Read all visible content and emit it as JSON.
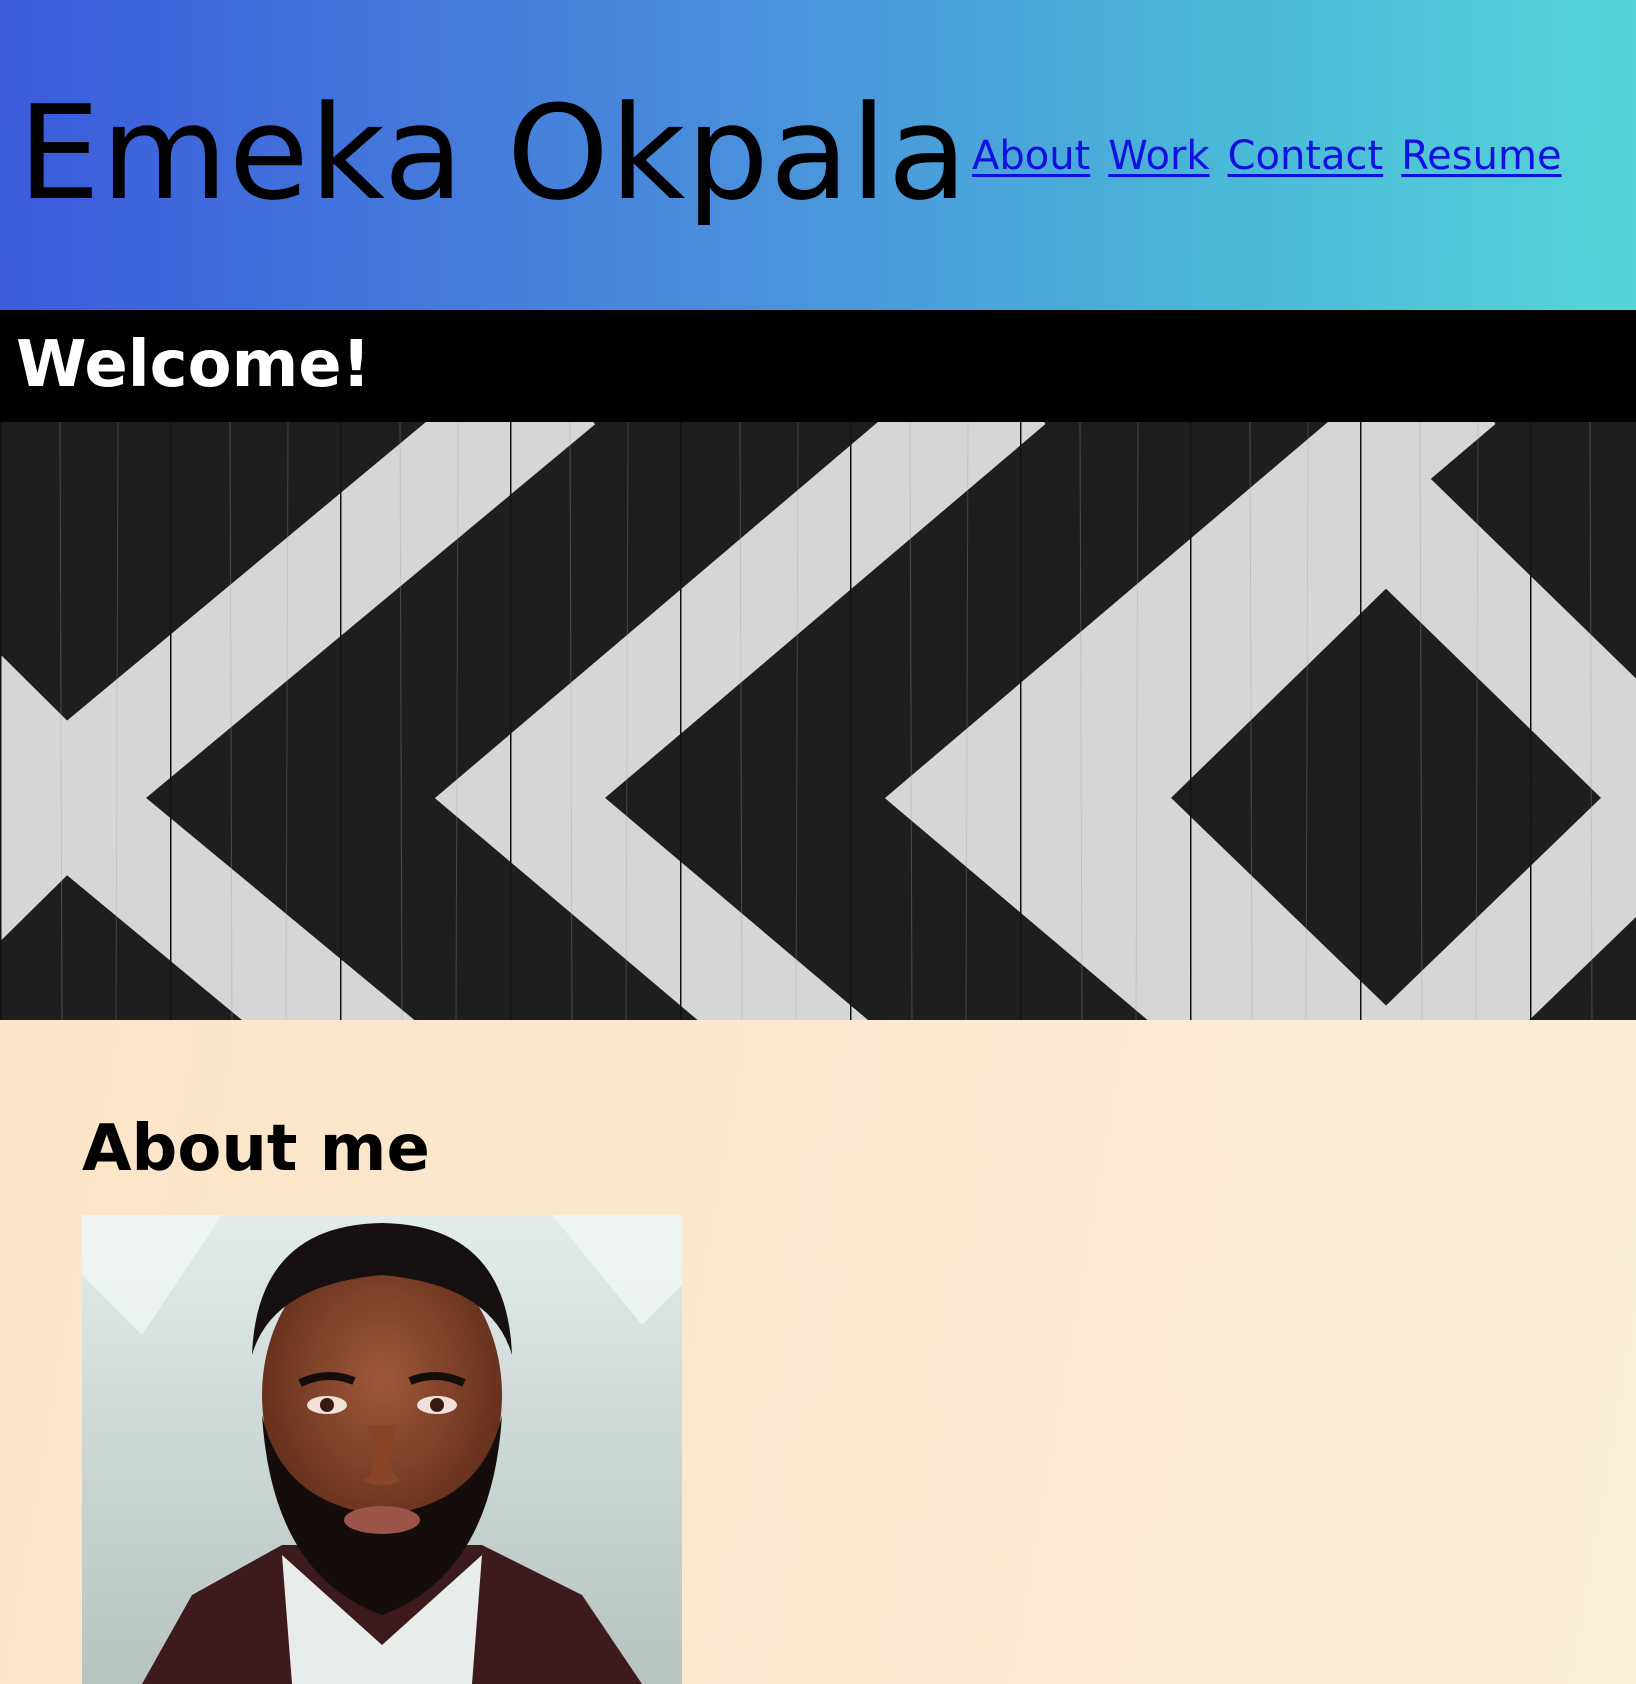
{
  "header": {
    "title": "Emeka Okpala",
    "nav": [
      {
        "label": "About"
      },
      {
        "label": "Work"
      },
      {
        "label": "Contact"
      },
      {
        "label": "Resume"
      }
    ]
  },
  "welcome": {
    "title": "Welcome!"
  },
  "hero": {
    "image": "black-and-white-painted-wood-geometric-pattern"
  },
  "about": {
    "heading": "About me",
    "portrait": "painted-portrait-of-bearded-man"
  },
  "colors": {
    "header_gradient_start": "#3b5bdb",
    "header_gradient_end": "#56d4d8",
    "nav_link": "#1010e0",
    "welcome_bg": "#000000",
    "welcome_text": "#ffffff",
    "about_bg": "#fae9cf"
  }
}
